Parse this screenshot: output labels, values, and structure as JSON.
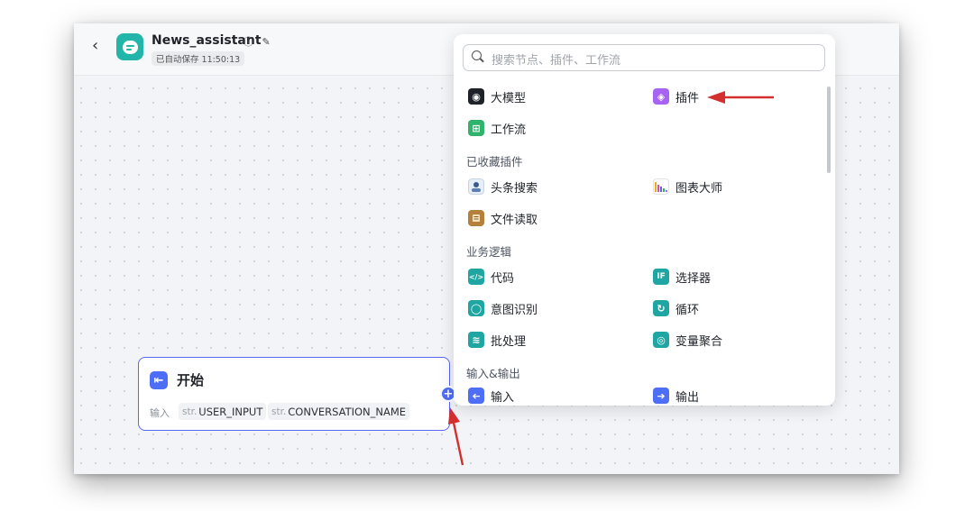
{
  "header": {
    "back_label": "‹",
    "app_title": "News_assistant",
    "info_icon": "ⓘ",
    "edit_icon": "✎",
    "autosave_text": "已自动保存 11:50:13"
  },
  "node_panel": {
    "search_placeholder": "搜索节点、插件、工作流",
    "items": {
      "llm": {
        "label": "大模型",
        "icon": "model-icon",
        "color": "#1f2329"
      },
      "plugin": {
        "label": "插件",
        "icon": "plugin-cube-icon",
        "color": "#a763f2"
      },
      "workflow": {
        "label": "工作流",
        "icon": "workflow-icon",
        "color": "#2fb36d"
      }
    },
    "sections": {
      "favorites": "已收藏插件",
      "business_logic": "业务逻辑",
      "io": "输入&输出"
    },
    "favorites": {
      "toutiao_search": {
        "label": "头条搜索",
        "icon": "toutiao-search-icon"
      },
      "chart_master": {
        "label": "图表大师",
        "icon": "chart-bars-icon"
      },
      "file_read": {
        "label": "文件读取",
        "icon": "file-read-icon"
      }
    },
    "logic": {
      "code": {
        "label": "代码",
        "glyph": "</>",
        "color": "#1fa6a2"
      },
      "selector": {
        "label": "选择器",
        "glyph": "IF",
        "color": "#1fa6a2"
      },
      "intent": {
        "label": "意图识别",
        "glyph": "◯",
        "color": "#1fa6a2"
      },
      "loop": {
        "label": "循环",
        "glyph": "↻",
        "color": "#1fa6a2"
      },
      "batch": {
        "label": "批处理",
        "glyph": "≋",
        "color": "#1fa6a2"
      },
      "var_aggregate": {
        "label": "变量聚合",
        "glyph": "◎",
        "color": "#1fa6a2"
      }
    },
    "io": {
      "input": {
        "label": "输入",
        "glyph": "➔",
        "color": "#4f6ef7"
      },
      "output": {
        "label": "输出",
        "glyph": "➔",
        "color": "#4f6ef7"
      }
    }
  },
  "start_node": {
    "title": "开始",
    "icon_glyph": "⇤",
    "input_label": "输入",
    "params": [
      {
        "type": "str.",
        "name": "USER_INPUT"
      },
      {
        "type": "str.",
        "name": "CONVERSATION_NAME"
      }
    ],
    "add_port": "+"
  },
  "colors": {
    "accent": "#4f6ef7",
    "annotation_arrow": "#d32f2f",
    "node_border": "#5b66f5"
  }
}
